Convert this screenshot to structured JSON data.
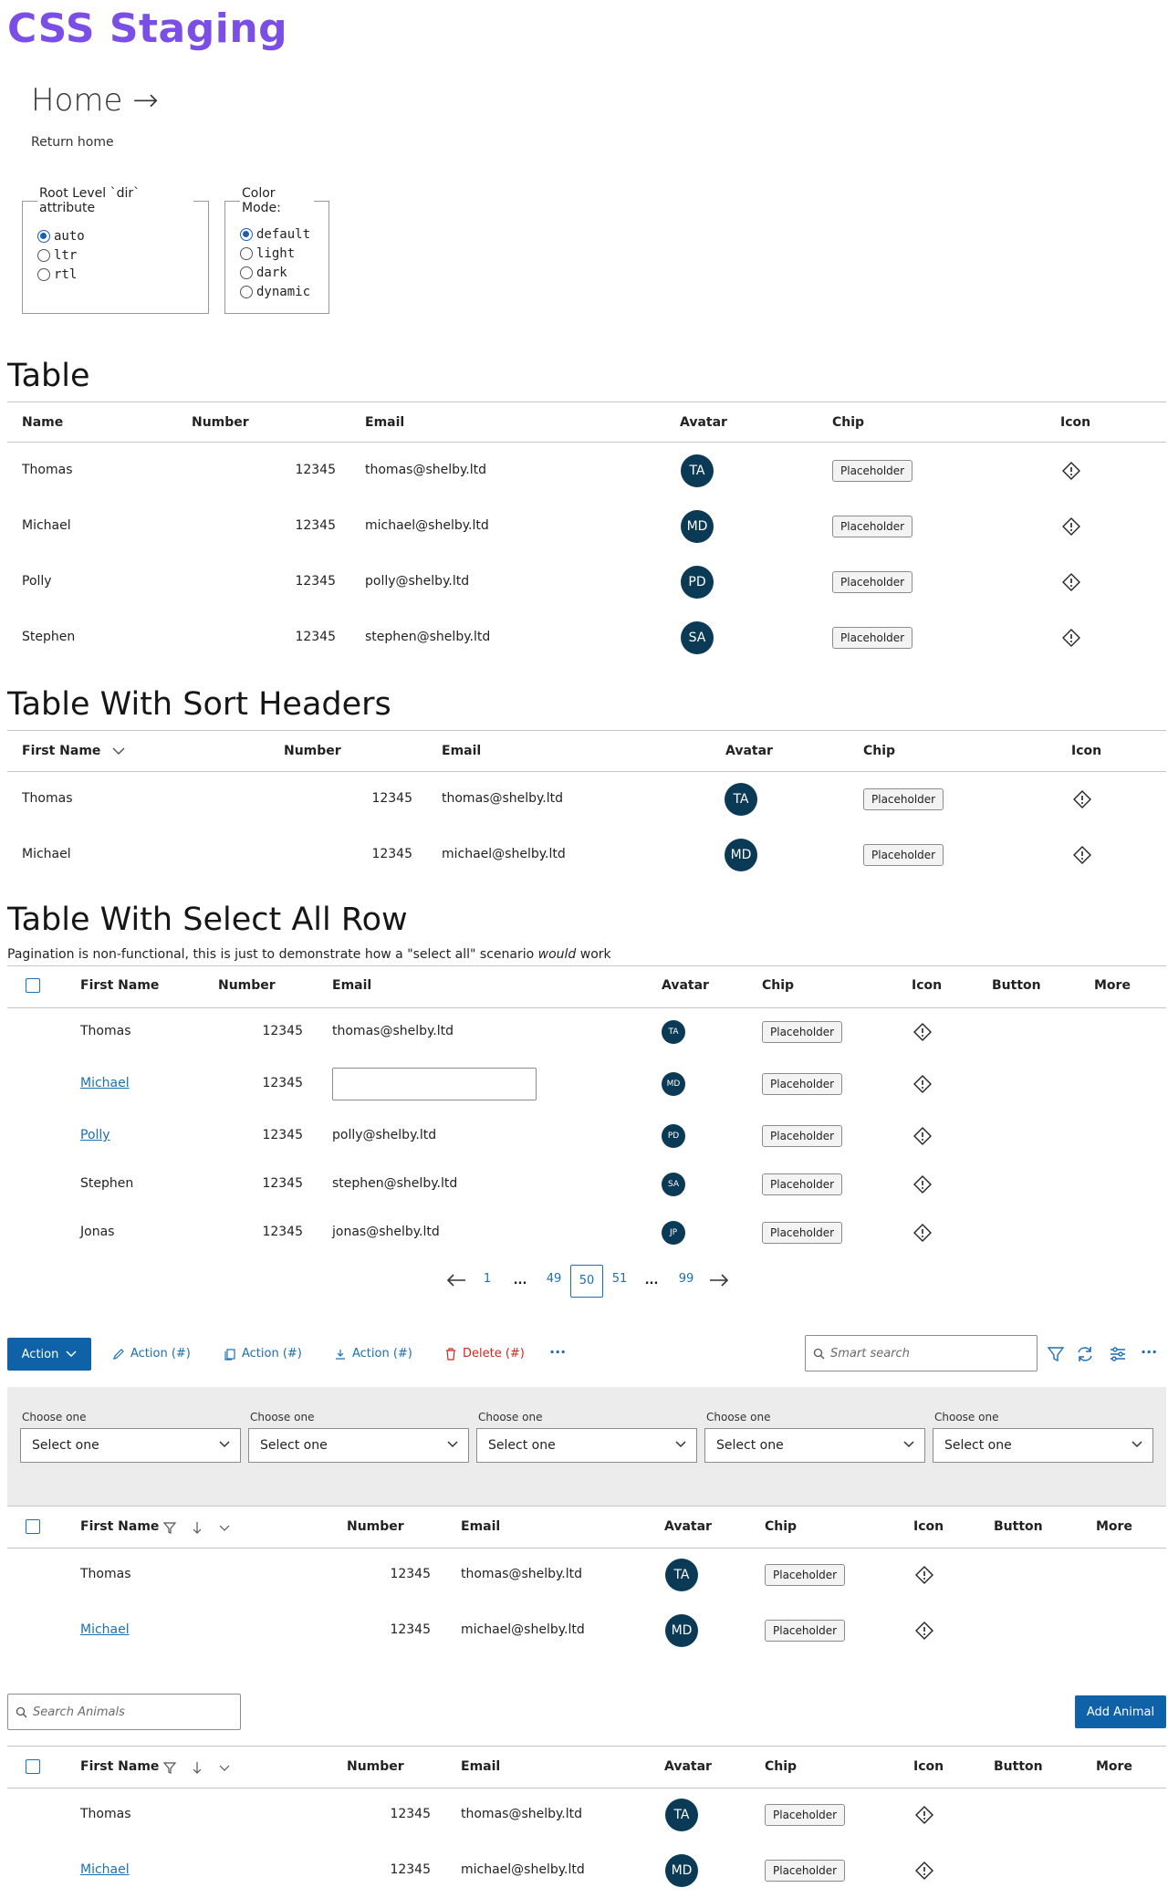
{
  "app": {
    "title": "CSS Staging"
  },
  "nav": {
    "home_label": "Home →",
    "return_label": "Return home"
  },
  "controls": {
    "dir_legend": "Root Level `dir` attribute",
    "dir_options": [
      "auto",
      "ltr",
      "rtl"
    ],
    "dir_selected": "auto",
    "color_legend": "Color Mode:",
    "color_options": [
      "default",
      "light",
      "dark",
      "dynamic"
    ],
    "color_selected": "default"
  },
  "table1": {
    "title": "Table",
    "headers": [
      "Name",
      "Number",
      "Email",
      "Avatar",
      "Chip",
      "Icon"
    ],
    "rows": [
      {
        "name": "Thomas",
        "number": "12345",
        "email": "thomas@shelby.ltd",
        "avatar": "TA",
        "chip": "Placeholder"
      },
      {
        "name": "Michael",
        "number": "12345",
        "email": "michael@shelby.ltd",
        "avatar": "MD",
        "chip": "Placeholder"
      },
      {
        "name": "Polly",
        "number": "12345",
        "email": "polly@shelby.ltd",
        "avatar": "PD",
        "chip": "Placeholder"
      },
      {
        "name": "Stephen",
        "number": "12345",
        "email": "stephen@shelby.ltd",
        "avatar": "SA",
        "chip": "Placeholder"
      }
    ]
  },
  "table2": {
    "title": "Table With Sort Headers",
    "headers": [
      "First Name",
      "Number",
      "Email",
      "Avatar",
      "Chip",
      "Icon"
    ],
    "rows": [
      {
        "name": "Thomas",
        "number": "12345",
        "email": "thomas@shelby.ltd",
        "avatar": "TA",
        "chip": "Placeholder"
      },
      {
        "name": "Michael",
        "number": "12345",
        "email": "michael@shelby.ltd",
        "avatar": "MD",
        "chip": "Placeholder"
      }
    ]
  },
  "table3": {
    "title": "Table With Select All Row",
    "subtitle_pre": "Pagination is non-functional, this is just to demonstrate how a \"select all\" scenario ",
    "subtitle_em": "would",
    "subtitle_post": " work",
    "headers": [
      "First Name",
      "Number",
      "Email",
      "Avatar",
      "Chip",
      "Icon",
      "Button",
      "More"
    ],
    "rows": [
      {
        "name": "Thomas",
        "number": "12345",
        "email": "thomas@shelby.ltd",
        "avatar": "TA",
        "chip": "Placeholder"
      },
      {
        "name": "Michael",
        "number": "12345",
        "email": "",
        "avatar": "MD",
        "chip": "Placeholder"
      },
      {
        "name": "Polly",
        "number": "12345",
        "email": "polly@shelby.ltd",
        "avatar": "PD",
        "chip": "Placeholder"
      },
      {
        "name": "Stephen",
        "number": "12345",
        "email": "stephen@shelby.ltd",
        "avatar": "SA",
        "chip": "Placeholder"
      },
      {
        "name": "Jonas",
        "number": "12345",
        "email": "jonas@shelby.ltd",
        "avatar": "JP",
        "chip": "Placeholder"
      }
    ],
    "pagination": [
      "1",
      "...",
      "49",
      "50",
      "51",
      "...",
      "99"
    ],
    "current_page": "50"
  },
  "toolbar": {
    "primary": "Action",
    "actions": [
      "Action (#)",
      "Action (#)",
      "Action (#)"
    ],
    "delete": "Delete (#)",
    "more": "···",
    "search_placeholder": "Smart search"
  },
  "filters": {
    "label": "Choose one",
    "value": "Select one",
    "count": 5
  },
  "table4": {
    "headers": [
      "First Name",
      "Number",
      "Email",
      "Avatar",
      "Chip",
      "Icon",
      "Button",
      "More"
    ],
    "rows": [
      {
        "name": "Thomas",
        "number": "12345",
        "email": "thomas@shelby.ltd",
        "avatar": "TA",
        "chip": "Placeholder"
      },
      {
        "name": "Michael",
        "number": "12345",
        "email": "michael@shelby.ltd",
        "avatar": "MD",
        "chip": "Placeholder"
      }
    ]
  },
  "animals": {
    "search_placeholder": "Search Animals",
    "add_label": "Add Animal"
  },
  "table5": {
    "headers": [
      "First Name",
      "Number",
      "Email",
      "Avatar",
      "Chip",
      "Icon",
      "Button",
      "More"
    ],
    "rows": [
      {
        "name": "Thomas",
        "number": "12345",
        "email": "thomas@shelby.ltd",
        "avatar": "TA",
        "chip": "Placeholder"
      },
      {
        "name": "Michael",
        "number": "12345",
        "email": "michael@shelby.ltd",
        "avatar": "MD",
        "chip": "Placeholder"
      }
    ]
  },
  "colors": {
    "brand": "#7b4ee6",
    "primary": "#0f62a8",
    "link": "#1a6fb5",
    "avatar": "#0b3a57",
    "danger": "#d0281c"
  },
  "icons": [
    "warning-diamond-icon",
    "chevron-down-icon",
    "filter-icon",
    "refresh-icon",
    "sliders-icon",
    "search-icon",
    "arrow-left-icon",
    "arrow-right-icon",
    "pencil-icon",
    "copy-icon",
    "download-icon",
    "trash-icon",
    "sort-down-icon"
  ]
}
